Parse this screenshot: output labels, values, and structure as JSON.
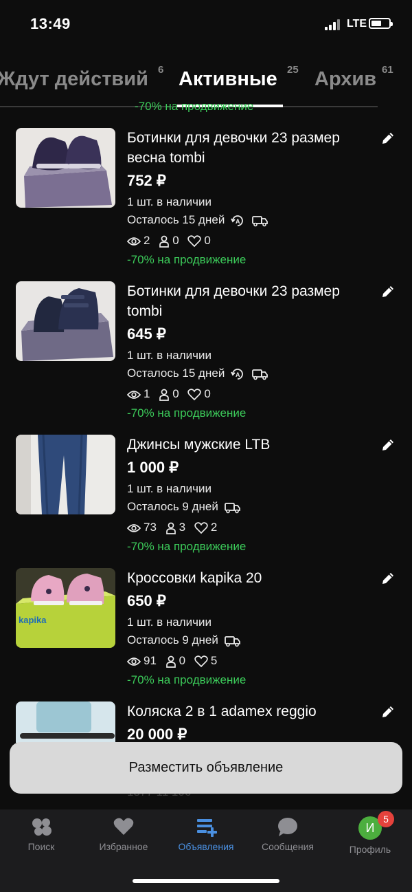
{
  "status_bar": {
    "time": "13:49",
    "network": "LTE"
  },
  "tabs": [
    {
      "label": "Ждут действий",
      "count": "6"
    },
    {
      "label": "Активные",
      "count": "25"
    },
    {
      "label": "Архив",
      "count": "61"
    }
  ],
  "peek_promo": "-70% на продвижение",
  "listings": [
    {
      "title": "Ботинки для девочки 23 размер весна tombi",
      "price": "752 ₽",
      "stock": "1 шт. в наличии",
      "remaining": "Осталось 15 дней",
      "views": "2",
      "contacts": "0",
      "favorites": "0",
      "promo": "-70% на продвижение"
    },
    {
      "title": "Ботинки для девочки 23 размер tombi",
      "price": "645 ₽",
      "stock": "1 шт. в наличии",
      "remaining": "Осталось 15 дней",
      "views": "1",
      "contacts": "0",
      "favorites": "0",
      "promo": "-70% на продвижение"
    },
    {
      "title": "Джинсы мужские LTB",
      "price": "1 000 ₽",
      "stock": "1 шт. в наличии",
      "remaining": "Осталось 9 дней",
      "views": "73",
      "contacts": "3",
      "favorites": "2",
      "promo": "-70% на продвижение"
    },
    {
      "title": "Кроссовки kapika 20",
      "price": "650 ₽",
      "stock": "1 шт. в наличии",
      "remaining": "Осталось 9 дней",
      "views": "91",
      "contacts": "0",
      "favorites": "5",
      "promo": "-70% на продвижение"
    },
    {
      "title": "Коляска 2 в 1 adamex reggio",
      "price": "20 000 ₽"
    }
  ],
  "hidden_stats": "1377  11  106",
  "cta_label": "Разместить объявление",
  "bottom_nav": [
    {
      "label": "Поиск",
      "icon": "search-icon"
    },
    {
      "label": "Избранное",
      "icon": "heart-icon"
    },
    {
      "label": "Объявления",
      "icon": "listings-icon"
    },
    {
      "label": "Сообщения",
      "icon": "chat-icon"
    },
    {
      "label": "Профиль",
      "icon": "avatar",
      "avatar_letter": "И",
      "badge": "5"
    }
  ],
  "colors": {
    "promo_green": "#3ccb5a",
    "accent_blue": "#4a8fe0",
    "badge_red": "#e5423c"
  }
}
